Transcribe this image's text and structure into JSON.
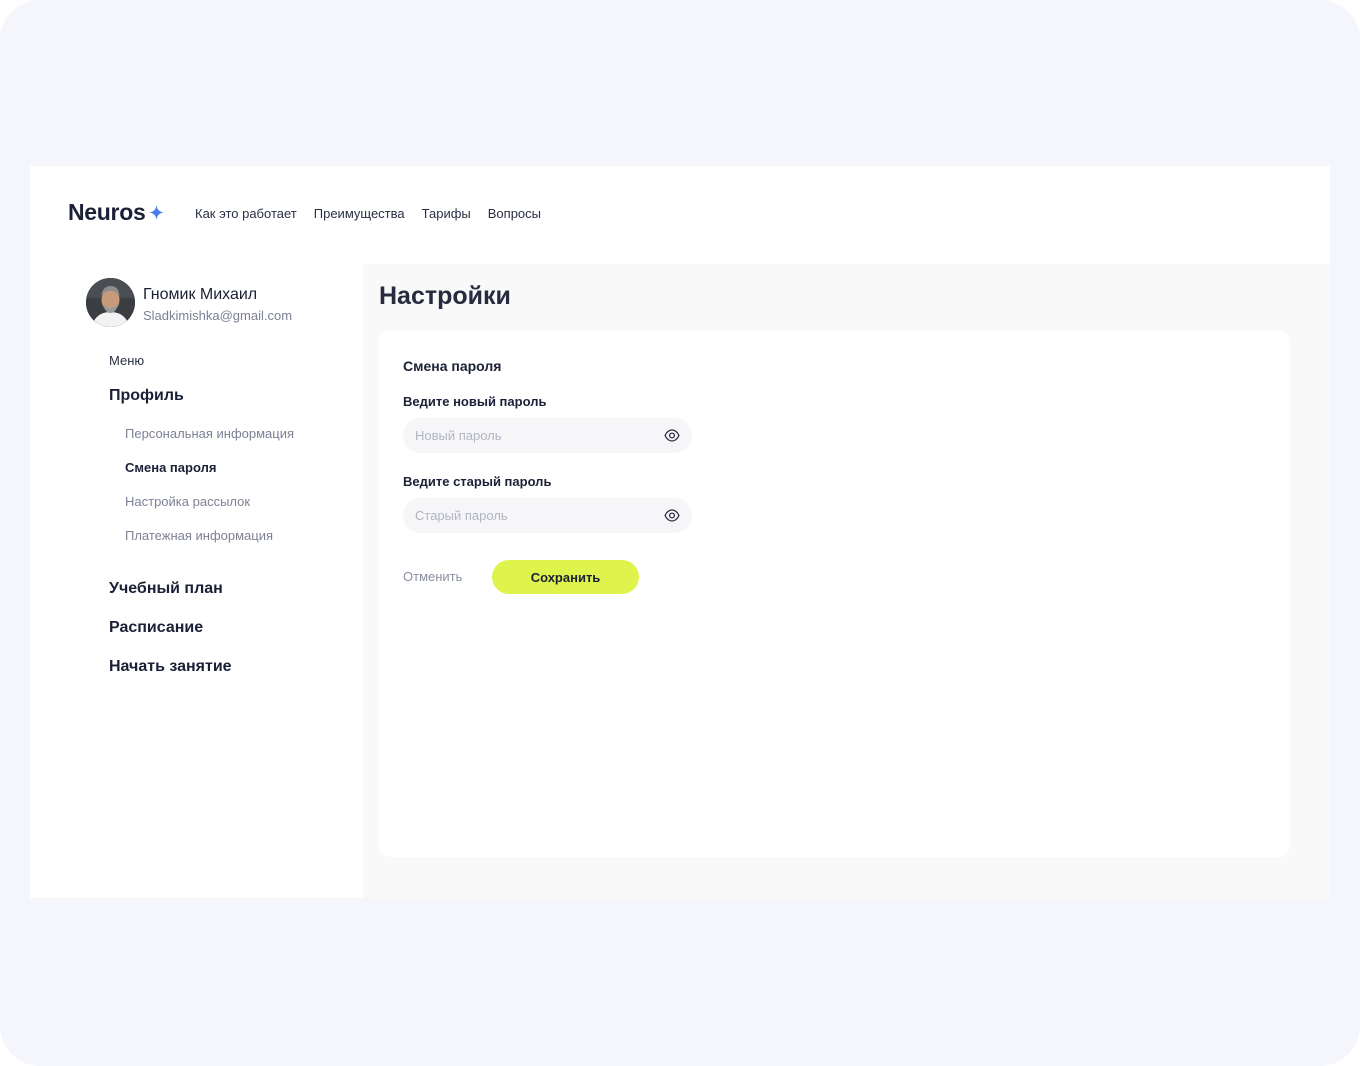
{
  "header": {
    "logo": "Neuros",
    "nav": [
      {
        "label": "Как это работает"
      },
      {
        "label": "Преимущества"
      },
      {
        "label": "Тарифы"
      },
      {
        "label": "Вопросы"
      }
    ]
  },
  "user": {
    "name": "Гномик Михаил",
    "email": "Sladkimishka@gmail.com"
  },
  "sidebar": {
    "caption": "Меню",
    "profile": {
      "label": "Профиль",
      "items": [
        {
          "label": "Персональная информация"
        },
        {
          "label": "Смена пароля",
          "active": true
        },
        {
          "label": "Настройка рассылок"
        },
        {
          "label": "Платежная информация"
        }
      ]
    },
    "sections": [
      {
        "label": "Учебный план"
      },
      {
        "label": "Расписание"
      },
      {
        "label": "Начать занятие"
      }
    ]
  },
  "main": {
    "title": "Настройки",
    "card": {
      "title": "Смена пароля",
      "new_password": {
        "label": "Ведите новый пароль",
        "placeholder": "Новый пароль",
        "value": ""
      },
      "old_password": {
        "label": "Ведите старый пароль",
        "placeholder": "Старый пароль",
        "value": ""
      },
      "cancel_label": "Отменить",
      "save_label": "Сохранить"
    }
  },
  "colors": {
    "accent": "#def34b",
    "logo_star": "#4a7cf0",
    "page_background": "#f5f6fc",
    "text_primary": "#1b2036"
  },
  "icons": {
    "logo": "sparkle-icon",
    "password_toggle": "eye-icon"
  }
}
